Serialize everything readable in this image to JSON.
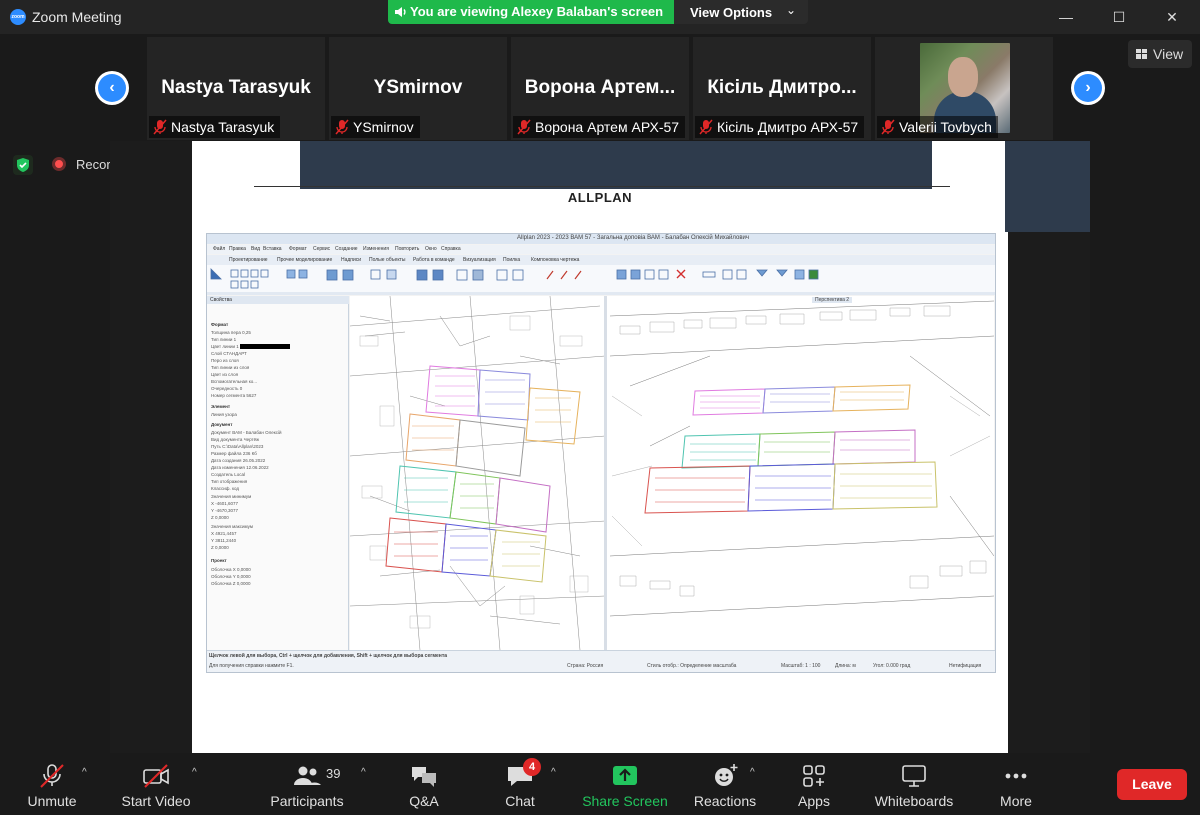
{
  "window": {
    "title": "Zoom Meeting",
    "logo_text": "zoom",
    "minimize": "—",
    "maximize": "☐",
    "close": "✕"
  },
  "share_banner": {
    "text": "You are viewing Alexey Balaban's screen",
    "view_options": "View Options",
    "view_options_chevron": "⌄"
  },
  "participants_strip": {
    "prev_arrow": "‹",
    "next_arrow": "›",
    "view_label": "View",
    "tiles": [
      {
        "display": "Nastya Tarasyuk",
        "name": "Nastya Tarasyuk",
        "muted": true
      },
      {
        "display": "YSmirnov",
        "name": "YSmirnov",
        "muted": true
      },
      {
        "display": "Ворона Артем...",
        "name": "Ворона Артем АРХ-57",
        "muted": true
      },
      {
        "display": "Кісіль Дмитро...",
        "name": "Кісіль Дмитро АРХ-57",
        "muted": true
      },
      {
        "display": "",
        "name": "Valerii Tovbych",
        "muted": true,
        "has_video": true
      }
    ]
  },
  "status": {
    "recording_label": "Recording"
  },
  "shared_screen": {
    "heading": "ALLPLAN",
    "app_title": "Allplan 2023 - 2023 ВАМ 57 - Загальна доповіа ВАМ - Балабан Олексій Михайлович",
    "menu": [
      "Файл",
      "Правка",
      "Вид",
      "Вставка",
      "Формат",
      "Сервис",
      "Создание",
      "Изменения",
      "Повторить",
      "Окно",
      "Справка"
    ],
    "tabs": [
      "Проектирование",
      "Прочее моделирование",
      "Надписи",
      "Полые объекты",
      "Работа в команде",
      "Визуализация",
      "Поилка",
      "Компоновка чертежа"
    ],
    "properties_title": "Свойства",
    "properties_sections": [
      "Формат",
      "Элемент",
      "Документ",
      "Проект"
    ],
    "properties_rows": [
      {
        "label": "Толщина пера",
        "value": "0,25"
      },
      {
        "label": "Тип линии",
        "value": "1"
      },
      {
        "label": "Цвет линии",
        "value": "1"
      },
      {
        "label": "Слой",
        "value": "СТАНДАРТ"
      },
      {
        "label": "Перо из слоя",
        "value": ""
      },
      {
        "label": "Тип линии из слоя",
        "value": ""
      },
      {
        "label": "Цвет из слоя",
        "value": ""
      },
      {
        "label": "Вспомогательная ко...",
        "value": ""
      },
      {
        "label": "Очередность",
        "value": "0"
      },
      {
        "label": "Номер сегмента",
        "value": "5627"
      },
      {
        "label": "Линия узора",
        "value": ""
      },
      {
        "label": "Документ",
        "value": "ВАМ - Балабан Олексій"
      },
      {
        "label": "Вид документа",
        "value": "Чертёж"
      },
      {
        "label": "Путь",
        "value": "C:\\Data\\Allplan\\2023"
      },
      {
        "label": "Размер файла",
        "value": "236 Кб"
      },
      {
        "label": "Дата создания",
        "value": "26.05.2022"
      },
      {
        "label": "Дата изменения",
        "value": "12.06.2022"
      },
      {
        "label": "Создатель",
        "value": "Local"
      },
      {
        "label": "Тип отображения",
        "value": ""
      },
      {
        "label": "Классиф. код",
        "value": ""
      },
      {
        "label": "Значения минимум",
        "value": ""
      },
      {
        "label": "X",
        "value": "-4601,6077"
      },
      {
        "label": "Y",
        "value": "-4670,3077"
      },
      {
        "label": "Z",
        "value": "0,0000"
      },
      {
        "label": "Значения максимум",
        "value": ""
      },
      {
        "label": "X",
        "value": "4921,4457"
      },
      {
        "label": "Y",
        "value": "3811,2440"
      },
      {
        "label": "Z",
        "value": "0,0000"
      },
      {
        "label": "Документ",
        "value": ""
      },
      {
        "label": "Оболочка X",
        "value": "0,0000"
      },
      {
        "label": "Оболочка Y",
        "value": "0,0000"
      },
      {
        "label": "Оболочка Z",
        "value": "0,0000"
      }
    ],
    "viewport_right_label": "Перспектива 2",
    "status_hint": "Щелчок левой для выбора, Ctrl + щелчок для добавления, Shift + щелчок для выбора сегмента",
    "status_help": "Для получения справки нажмите F1.",
    "status_country": "Страна: Россия",
    "status_input": "Стиль отобр.: Определение масштаба",
    "status_scale": "Масштаб: 1 : 100",
    "status_length": "Длина: м",
    "status_angle": "Угол: 0.000 град",
    "status_extra": "Нетифицация"
  },
  "toolbar": {
    "unmute": "Unmute",
    "start_video": "Start Video",
    "participants": "Participants",
    "participants_count": "39",
    "qa": "Q&A",
    "chat": "Chat",
    "chat_badge": "4",
    "share_screen": "Share Screen",
    "reactions": "Reactions",
    "apps": "Apps",
    "whiteboards": "Whiteboards",
    "more": "More",
    "leave": "Leave",
    "caret": "^"
  },
  "colors": {
    "zoom_blue": "#2d8cff",
    "share_green": "#1fb94b",
    "leave_red": "#e02828",
    "mic_muted_red": "#e02828"
  }
}
